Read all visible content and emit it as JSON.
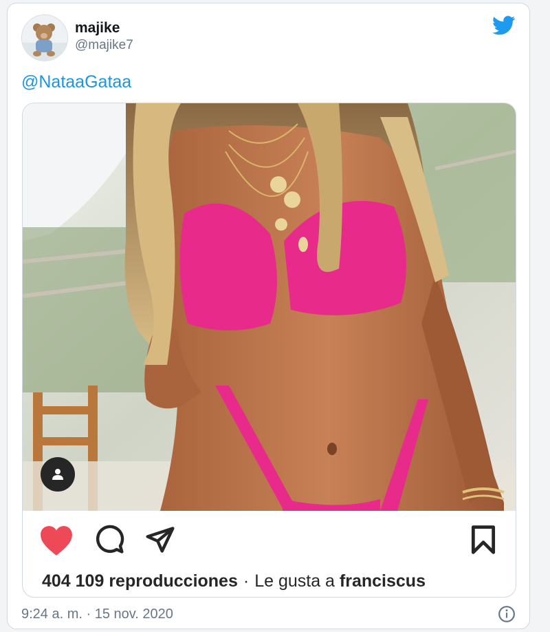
{
  "tweet": {
    "user": {
      "name": "majike",
      "handle": "@majike7",
      "avatar_icon": "teddy-bear-avatar"
    },
    "logo_icon": "twitter-bird-icon",
    "text": "@NataaGataa",
    "embed": {
      "stats": {
        "views": "404 109 reproducciones",
        "separator": "·",
        "liked_by_prefix": "Le gusta a",
        "liked_by_user": "franciscus"
      },
      "icons": [
        "heart-icon",
        "comment-icon",
        "share-icon",
        "bookmark-icon",
        "user-tag-icon"
      ]
    },
    "timestamp": "9:24 a. m. · 15 nov. 2020",
    "info_icon": "info-icon"
  },
  "colors": {
    "link": "#1b95e0",
    "twitter_blue": "#1d9bf0",
    "like_red": "#ed4956",
    "muted": "#657786",
    "bikini_pink": "#e82a8a"
  }
}
